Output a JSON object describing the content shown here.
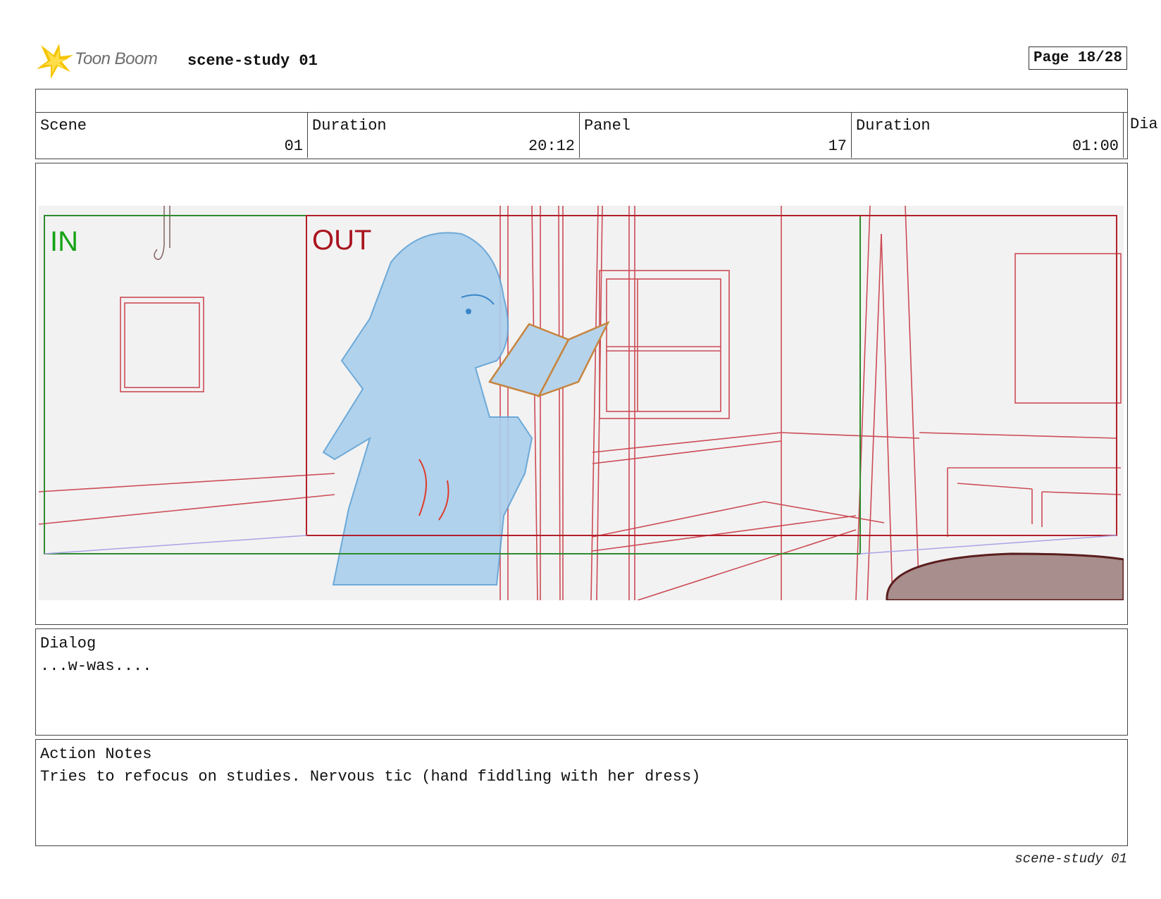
{
  "header": {
    "logo_text": "Toon Boom",
    "project_title": "scene-study 01",
    "page_label": "Page 18/28"
  },
  "info": {
    "scene_label": "Scene",
    "scene_value": "01",
    "scene_duration_label": "Duration",
    "scene_duration_value": "20:12",
    "panel_label": "Panel",
    "panel_value": "17",
    "panel_duration_label": "Duration",
    "panel_duration_value": "01:00",
    "dialog_cut_label": "Dia"
  },
  "panel_image": {
    "in_label": "IN",
    "out_label": "OUT",
    "colors": {
      "in_frame": "#2e8b2e",
      "out_frame": "#b3202a",
      "sketch_lines": "#cc4b55",
      "character": "#a9cfec",
      "book": "#c7843e",
      "tabletop": "#a88e8c"
    }
  },
  "dialog": {
    "label": "Dialog",
    "text": "...w-was...."
  },
  "action_notes": {
    "label": "Action Notes",
    "text": "Tries to refocus on studies. Nervous tic (hand fiddling with her dress)"
  },
  "footer": {
    "text": "scene-study 01"
  }
}
